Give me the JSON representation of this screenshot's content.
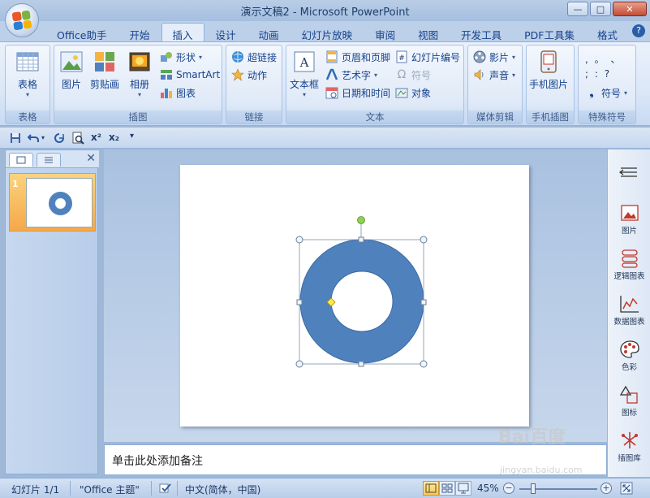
{
  "window": {
    "title": "演示文稿2 - Microsoft PowerPoint",
    "buttons": {
      "minimize": "—",
      "maximize": "□",
      "close": "✕"
    }
  },
  "tabs": [
    {
      "label": "Office助手",
      "active": false
    },
    {
      "label": "开始",
      "active": false
    },
    {
      "label": "插入",
      "active": true
    },
    {
      "label": "设计",
      "active": false
    },
    {
      "label": "动画",
      "active": false
    },
    {
      "label": "幻灯片放映",
      "active": false
    },
    {
      "label": "审阅",
      "active": false
    },
    {
      "label": "视图",
      "active": false
    },
    {
      "label": "开发工具",
      "active": false
    },
    {
      "label": "PDF工具集",
      "active": false
    },
    {
      "label": "格式",
      "active": false
    }
  ],
  "help_label": "?",
  "ribbon": {
    "table_group": {
      "label": "表格",
      "table_button": "表格"
    },
    "illustrations_group": {
      "label": "插图",
      "picture": "图片",
      "clipart": "剪贴画",
      "album": "相册",
      "shapes": "形状",
      "smartart": "SmartArt",
      "chart": "图表"
    },
    "links_group": {
      "label": "链接",
      "hyperlink": "超链接",
      "action": "动作"
    },
    "text_group": {
      "label": "文本",
      "textbox": "文本框",
      "header_footer": "页眉和页脚",
      "wordart": "艺术字",
      "datetime": "日期和时间",
      "slide_number": "幻灯片编号",
      "symbol": "符号",
      "object": "对象"
    },
    "media_group": {
      "label": "媒体剪辑",
      "movie": "影片",
      "sound": "声音"
    },
    "mobile_group": {
      "label": "手机插图",
      "mobile_picture": "手机图片"
    },
    "special_group": {
      "label": "特殊符号",
      "symbol": "符号",
      "symbols_row1": ",  。  、",
      "symbols_row2": ";   :   ?"
    }
  },
  "qat": {
    "superscript": "x²",
    "subscript": "x₂",
    "more": "▾"
  },
  "slides_panel": {
    "slide_number": "1"
  },
  "notes": {
    "placeholder": "单击此处添加备注"
  },
  "right_tools": [
    {
      "label": "图片"
    },
    {
      "label": "逻辑图表"
    },
    {
      "label": "数据图表"
    },
    {
      "label": "色彩"
    },
    {
      "label": "图标"
    },
    {
      "label": "插图库"
    }
  ],
  "status": {
    "slide_info": "幻灯片 1/1",
    "theme": "\"Office 主题\"",
    "language": "中文(简体，中国)",
    "zoom": "45%",
    "zoom_minus": "−",
    "zoom_plus": "+"
  },
  "colors": {
    "shape_fill": "#4f81bd",
    "shape_outline": "#3a6aa3",
    "rotate_handle": "#8fd14f",
    "adjust_handle": "#ffeb3b"
  },
  "watermark": {
    "brand": "Bai百度",
    "sub": "jingyan.baidu.com"
  }
}
